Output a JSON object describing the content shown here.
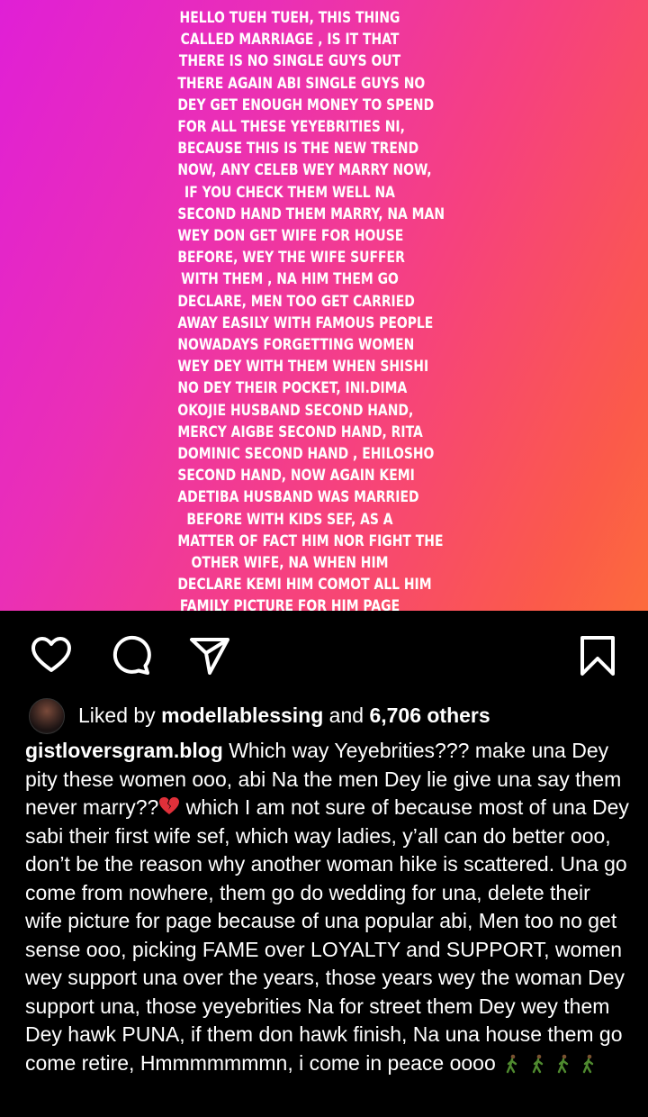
{
  "post": {
    "lines": [
      "HELLO TUEH TUEH, THIS THING",
      "CALLED MARRIAGE , IS IT THAT",
      "THERE IS NO SINGLE GUYS OUT",
      "THERE AGAIN ABI SINGLE GUYS NO",
      "DEY GET ENOUGH MONEY TO SPEND",
      "FOR ALL THESE YEYEBRITIES NI,",
      "BECAUSE THIS IS THE NEW TREND",
      "NOW, ANY CELEB WEY MARRY NOW,",
      "IF YOU CHECK THEM WELL NA",
      "SECOND HAND THEM MARRY, NA MAN",
      "WEY DON GET WIFE FOR HOUSE",
      "BEFORE, WEY THE WIFE SUFFER",
      "WITH THEM , NA HIM THEM GO",
      "DECLARE, MEN TOO GET CARRIED",
      "AWAY EASILY WITH FAMOUS PEOPLE",
      "NOWADAYS FORGETTING WOMEN",
      "WEY DEY WITH THEM WHEN SHISHI",
      "NO DEY THEIR POCKET, INI.DIMA",
      "OKOJIE HUSBAND SECOND HAND,",
      "MERCY AIGBE SECOND HAND, RITA",
      "DOMINIC SECOND HAND , EHILOSHO",
      "SECOND HAND, NOW AGAIN KEMI",
      "ADETIBA HUSBAND WAS MARRIED",
      "BEFORE WITH KIDS SEF, AS A",
      "MATTER OF FACT HIM NOR FIGHT THE",
      "OTHER WIFE, NA WHEN HIM",
      "DECLARE KEMI HIM COMOT ALL HIM",
      "FAMILY PICTURE FOR HIM PAGE"
    ]
  },
  "icons": {
    "like": "heart-icon",
    "comment": "comment-icon",
    "share": "send-icon",
    "save": "bookmark-icon"
  },
  "likes": {
    "prefix": "Liked by",
    "user": "modellablessing",
    "middle": "and",
    "count": "6,706 others"
  },
  "caption": {
    "username": "gistloversgram.blog",
    "part1": "Which way Yeyebrities??? make una Dey pity these women ooo, abi Na the men Dey lie give una say them never marry??",
    "part2": " which I am not sure of because most of una Dey sabi their first wife sef, which way ladies, y’all can do better ooo, don’t be the reason why another woman hike is scattered. Una go come from nowhere, them go do wedding for una, delete their wife picture for page because of una popular abi, Men too no get sense ooo, picking FAME over LOYALTY and SUPPORT, women wey support una over the years, those years wey the woman Dey support una, those yeyebrities Na for street them Dey wey them Dey hawk PUNA, if them don hawk finish, Na una house them go come retire, Hmmmmmmmn, i  come in peace oooo"
  },
  "colors": {
    "gradient_start": "#e01fd6",
    "gradient_end": "#fc6b3c",
    "broken_heart": "#e0303a",
    "walker": "#4f8a2f"
  }
}
